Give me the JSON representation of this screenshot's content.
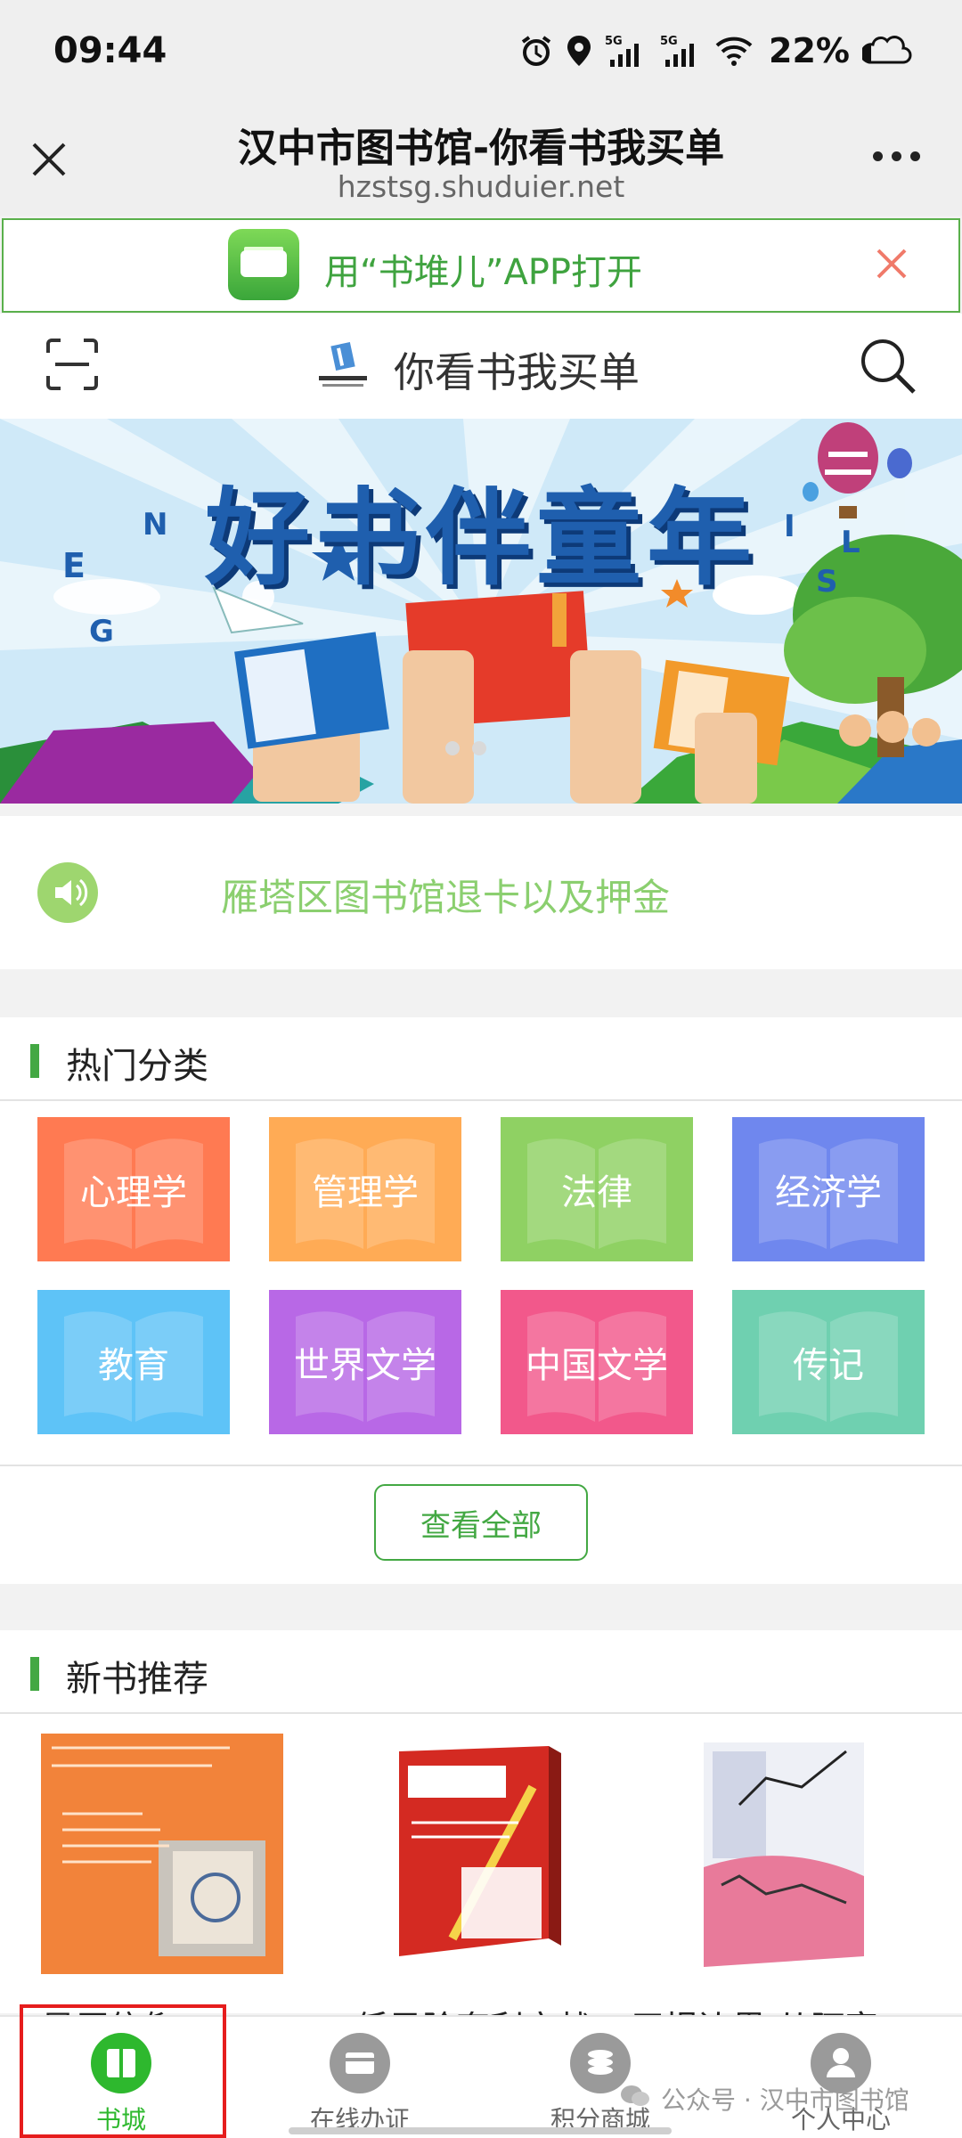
{
  "status_bar": {
    "time": "09:44",
    "battery": "22%",
    "signal1": "5G",
    "signal2": "5G"
  },
  "browser": {
    "title": "汉中市图书馆-你看书我买单",
    "url": "hzstsg.shuduier.net"
  },
  "app_banner": {
    "text": "用“书堆儿”APP打开"
  },
  "site": {
    "name": "你看书我买单"
  },
  "hero": {
    "title": "好书伴童年"
  },
  "notice": {
    "text": "雁塔区图书馆退卡以及押金"
  },
  "categories": {
    "title": "热门分类",
    "items": [
      {
        "label": "心理学",
        "color": "#ff7a52"
      },
      {
        "label": "管理学",
        "color": "#ffab55"
      },
      {
        "label": "法律",
        "color": "#8fd163"
      },
      {
        "label": "经济学",
        "color": "#6f87ee"
      },
      {
        "label": "教育",
        "color": "#5ec3f7"
      },
      {
        "label": "世界文学",
        "color": "#b868e6"
      },
      {
        "label": "中国文学",
        "color": "#f2588b"
      },
      {
        "label": "传记",
        "color": "#6fd0b0"
      }
    ],
    "view_all": "查看全部"
  },
  "new_books": {
    "title": "新书推荐",
    "items": [
      {
        "title": "星辰信仰"
      },
      {
        "title": "低风险套利实战"
      },
      {
        "title": "无惧边界 从阿富…"
      }
    ]
  },
  "bottom_nav": {
    "items": [
      {
        "label": "书城",
        "active": true
      },
      {
        "label": "在线办证",
        "active": false
      },
      {
        "label": "积分商城",
        "active": false
      },
      {
        "label": "个人中心",
        "active": false
      }
    ]
  },
  "watermark": {
    "text": "公众号 · 汉中市图书馆"
  }
}
